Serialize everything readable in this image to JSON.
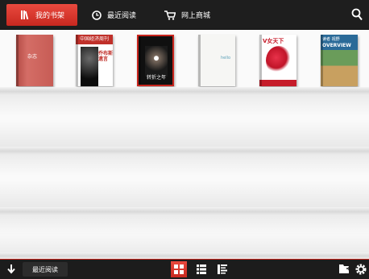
{
  "topbar": {
    "tabs": [
      {
        "label": "我的书架",
        "icon": "bookshelf-icon",
        "active": true
      },
      {
        "label": "最近阅读",
        "icon": "clock-icon",
        "active": false
      },
      {
        "label": "网上商城",
        "icon": "cart-icon",
        "active": false
      }
    ],
    "search_icon": "search-icon"
  },
  "shelf": {
    "books": [
      {
        "title": "杂志"
      },
      {
        "header": "中国经济周刊",
        "subtitle": "乔布斯 遗言"
      },
      {
        "title": "转折之年"
      },
      {
        "title": "hello"
      },
      {
        "header": "V女天下"
      },
      {
        "header": "读者 视野",
        "title": "OVERVIEW"
      }
    ]
  },
  "bottombar": {
    "recent_label": "最近阅读",
    "icons": [
      "download-icon",
      "grid-view-icon",
      "list-view-icon",
      "detail-list-icon",
      "import-icon",
      "settings-icon"
    ]
  },
  "colors": {
    "accent": "#d2352c",
    "bar": "#1e1e1e"
  }
}
